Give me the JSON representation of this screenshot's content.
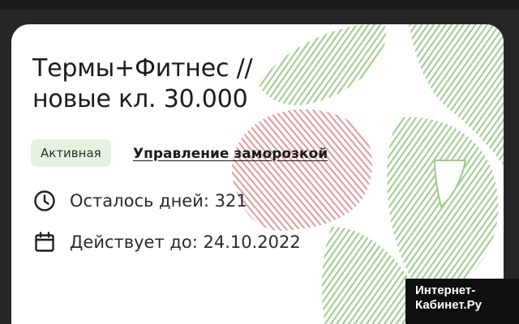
{
  "card": {
    "title_line1": "Термы+Фитнес //",
    "title_line2": "новые кл. 30.000",
    "status_badge": "Активная",
    "freeze_link": "Управление заморозкой",
    "days_left": "Осталось дней: 321",
    "valid_until": "Действует до: 24.10.2022"
  },
  "icons": {
    "days": "clock-icon",
    "until": "calendar-icon"
  },
  "watermark": {
    "line1": "Интернет-",
    "line2": "Кабинет.Ру"
  },
  "colors": {
    "badge_bg": "#e4f3df",
    "art_green": "#8cc47a",
    "art_red": "#d9868a",
    "text": "#1b1b1b"
  }
}
